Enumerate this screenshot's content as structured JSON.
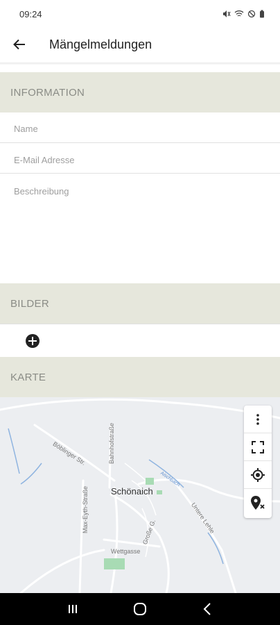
{
  "status_bar": {
    "time": "09:24"
  },
  "app_bar": {
    "title": "Mängelmeldungen"
  },
  "sections": {
    "information": "INFORMATION",
    "bilder": "BILDER",
    "karte": "KARTE"
  },
  "form": {
    "name_placeholder": "Name",
    "email_placeholder": "E-Mail Adresse",
    "description_placeholder": "Beschreibung"
  },
  "map": {
    "town": "Schönaich",
    "streets": [
      "Böblinger Str.",
      "Bahnhofstraße",
      "Max-Eyth-Straße",
      "Untere Lehle",
      "Wettgasse",
      "Große G.",
      "Aischbach"
    ]
  },
  "icons": {
    "back": "arrow-left-icon",
    "add": "plus-circle-icon",
    "menu": "more-vertical-icon",
    "fullscreen": "fullscreen-icon",
    "locate": "my-location-icon",
    "clear_marker": "marker-remove-icon"
  }
}
